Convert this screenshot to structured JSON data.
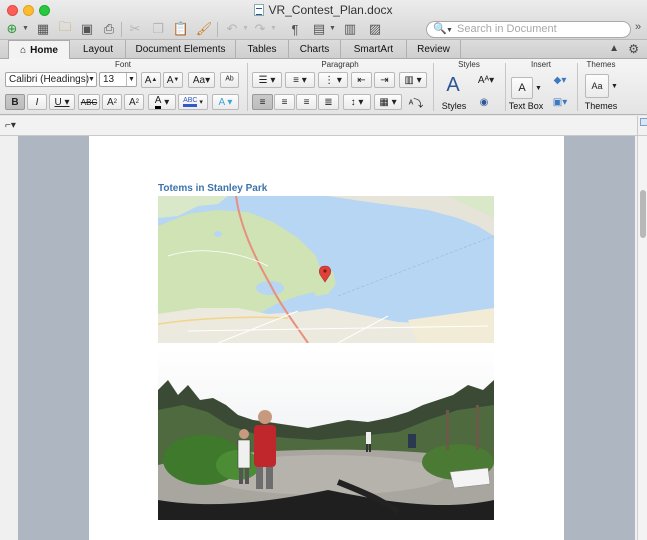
{
  "window": {
    "title": "VR_Contest_Plan.docx"
  },
  "search": {
    "placeholder": "Search in Document"
  },
  "tabs": [
    {
      "label": "Home",
      "active": true
    },
    {
      "label": "Layout"
    },
    {
      "label": "Document Elements"
    },
    {
      "label": "Tables"
    },
    {
      "label": "Charts"
    },
    {
      "label": "SmartArt"
    },
    {
      "label": "Review"
    }
  ],
  "ribbon": {
    "groups": {
      "font": "Font",
      "paragraph": "Paragraph",
      "styles": "Styles",
      "insert": "Insert",
      "themes": "Themes"
    },
    "font_name": "Calibri (Headings)",
    "font_size": "13",
    "styles_label": "Styles",
    "textbox_label": "Text Box",
    "themes_label": "Themes"
  },
  "document": {
    "heading": "Totems in Stanley Park"
  },
  "colors": {
    "heading": "#3f73ae",
    "map_water": "#b7d6f3",
    "map_land": "#d8e8c8",
    "map_road": "#e98f7d",
    "map_marker": "#e0403a"
  }
}
